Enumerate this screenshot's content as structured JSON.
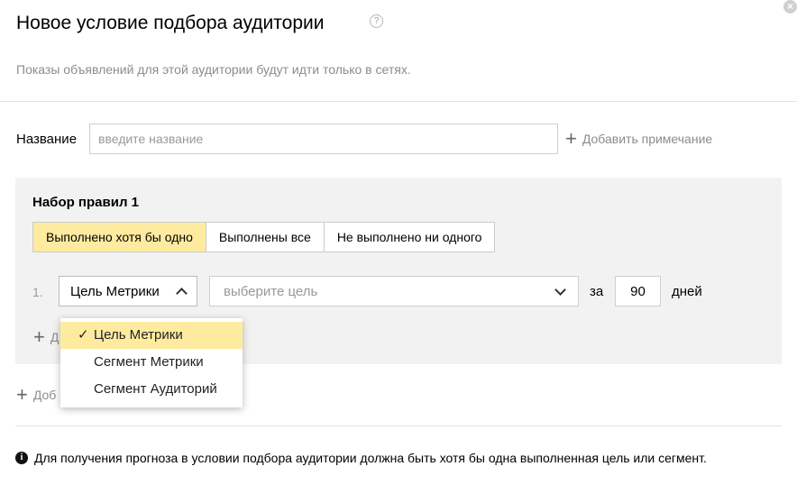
{
  "dialog": {
    "title": "Новое условие подбора аудитории",
    "help_icon": "?",
    "close_icon": "×",
    "subtitle": "Показы объявлений для этой аудитории будут идти только в сетях."
  },
  "name_field": {
    "label": "Название",
    "placeholder": "введите название",
    "value": ""
  },
  "add_note": {
    "icon": "+",
    "label": "Добавить примечание"
  },
  "ruleset": {
    "title": "Набор правил 1",
    "modes": [
      "Выполнено хотя бы одно",
      "Выполнены все",
      "Не выполнено ни одного"
    ],
    "active_mode": 0,
    "rule": {
      "number": "1.",
      "type_value": "Цель Метрики",
      "goal_placeholder": "выберите цель",
      "for_label": "за",
      "days_value": "90",
      "days_label": "дней"
    },
    "add_rule": {
      "icon": "+",
      "label": "Д"
    }
  },
  "add_set": {
    "icon": "+",
    "label": "Доб"
  },
  "type_dropdown": {
    "check": "✓",
    "options": [
      "Цель Метрики",
      "Сегмент Метрики",
      "Сегмент Аудиторий"
    ],
    "selected": 0
  },
  "info": {
    "icon": "i",
    "text": "Для получения прогноза в условии подбора аудитории должна быть хотя бы одна выполненная цель или сегмент."
  },
  "colors": {
    "highlight": "#ffeba0",
    "panel": "#f2f2f2",
    "muted_text": "#8c8c8c"
  }
}
